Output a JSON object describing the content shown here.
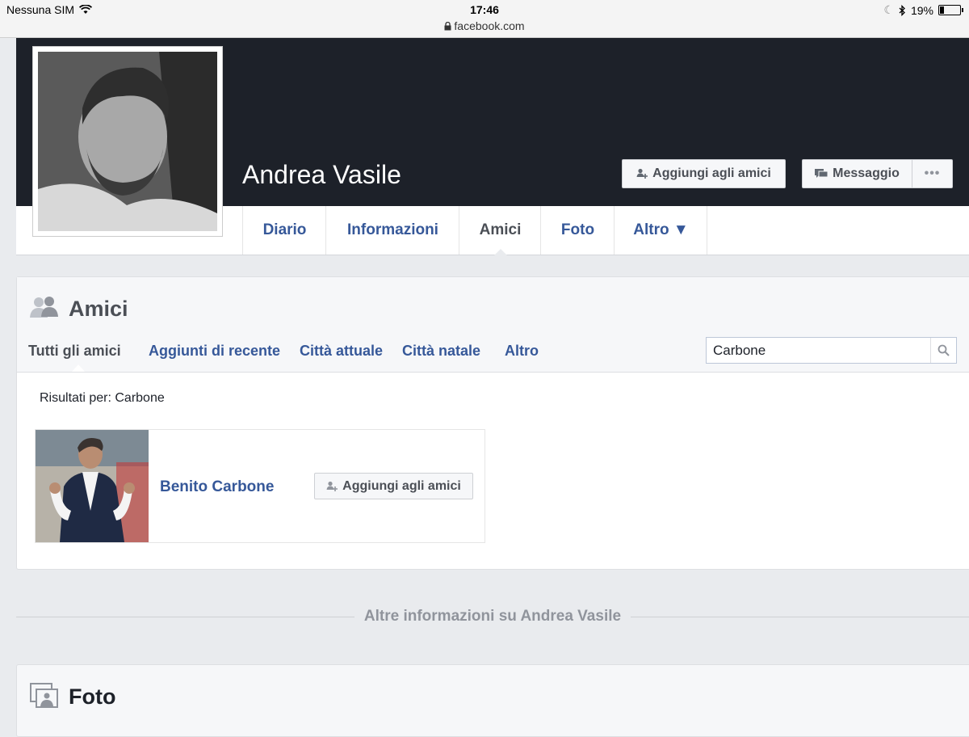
{
  "status_bar": {
    "carrier": "Nessuna SIM",
    "time": "17:46",
    "url": "facebook.com",
    "battery": "19%",
    "battery_level": 0.19
  },
  "profile": {
    "name": "Andrea Vasile",
    "add_friend_label": "Aggiungi agli amici",
    "message_label": "Messaggio",
    "more_label": "•••"
  },
  "nav": {
    "tabs": [
      {
        "label": "Diario"
      },
      {
        "label": "Informazioni"
      },
      {
        "label": "Amici"
      },
      {
        "label": "Foto"
      },
      {
        "label": "Altro ▼"
      }
    ],
    "active": "Amici"
  },
  "friends": {
    "title": "Amici",
    "subtabs": [
      {
        "label": "Tutti gli amici"
      },
      {
        "label": "Aggiunti di recente"
      },
      {
        "label": "Città attuale"
      },
      {
        "label": "Città natale"
      },
      {
        "label": "Altro"
      }
    ],
    "search_value": "Carbone",
    "results_label": "Risultati per: Carbone",
    "results": [
      {
        "name": "Benito Carbone",
        "add_label": "Aggiungi agli amici"
      }
    ]
  },
  "separator_label": "Altre informazioni su Andrea Vasile",
  "photos": {
    "title": "Foto"
  },
  "colors": {
    "link": "#365899",
    "cover": "#1d2129",
    "background": "#e9ebee"
  }
}
